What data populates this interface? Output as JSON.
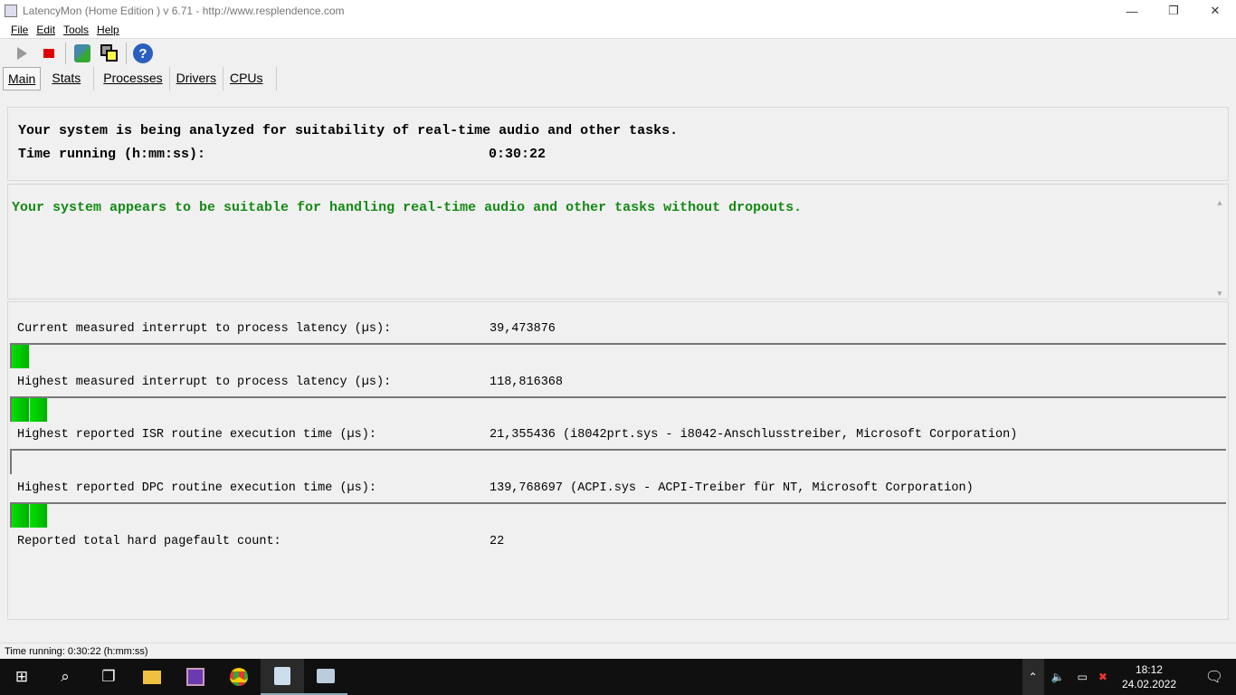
{
  "window": {
    "title": "LatencyMon  (Home Edition )  v 6.71 - http://www.resplendence.com",
    "minimize": "—",
    "restore": "❐",
    "close": "✕"
  },
  "menu": [
    "File",
    "Edit",
    "Tools",
    "Help"
  ],
  "toolbar": {
    "play": "play-icon",
    "stop": "stop-icon",
    "report": "report-icon",
    "windows": "windows-icon",
    "help": "help-icon"
  },
  "tabs": [
    "Main",
    "Stats",
    "Processes",
    "Drivers",
    "CPUs"
  ],
  "summary": {
    "line1": "Your system is being analyzed for suitability of real-time audio and other tasks.",
    "time_label": "Time running (h:mm:ss):",
    "time_value": "0:30:22"
  },
  "verdict": "Your system appears to be suitable for handling real-time audio and other tasks without dropouts.",
  "metrics": [
    {
      "label": "Current measured interrupt to process latency (µs):",
      "value": "39,473876",
      "bar_segments": 1
    },
    {
      "label": "Highest measured interrupt to process latency (µs):",
      "value": "118,816368",
      "bar_segments": 2
    },
    {
      "label": "Highest reported ISR routine execution time (µs):",
      "value": "21,355436  (i8042prt.sys - i8042-Anschlusstreiber, Microsoft Corporation)",
      "bar_segments": 0
    },
    {
      "label": "Highest reported DPC routine execution time (µs):",
      "value": "139,768697  (ACPI.sys - ACPI-Treiber für NT, Microsoft Corporation)",
      "bar_segments": 2
    },
    {
      "label": "Reported total hard pagefault count:",
      "value": "22"
    }
  ],
  "status": "Time running: 0:30:22  (h:mm:ss)",
  "taskbar": {
    "time": "18:12",
    "date": "24.02.2022"
  },
  "colors": {
    "verdict": "#138a13",
    "bar": "#00d000"
  }
}
